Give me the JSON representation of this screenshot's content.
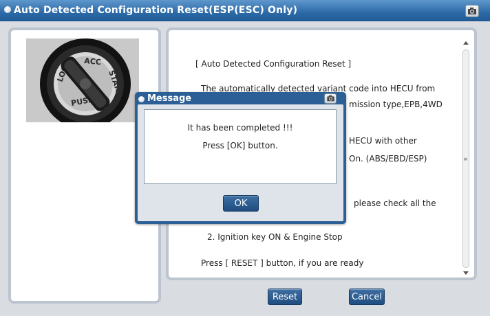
{
  "window": {
    "title": "Auto Detected Configuration Reset(ESP(ESC) Only)"
  },
  "key_photo": {
    "labels": [
      "LOCK",
      "ACC",
      "START",
      "PUSH"
    ]
  },
  "content": {
    "lines": [
      "[ Auto Detected Configuration Reset ]",
      "The automatically detected variant code into HECU from",
      "mission type,EPB,4WD",
      "HECU with other",
      "On. (ABS/EBD/ESP)",
      "please check all the",
      "2. Ignition key ON & Engine Stop",
      "Press [ RESET ] button, if you are ready"
    ]
  },
  "buttons": {
    "reset": "Reset",
    "cancel": "Cancel"
  },
  "message": {
    "title": "Message",
    "line1": "It has been completed !!!",
    "line2": "Press [OK] button.",
    "ok": "OK"
  },
  "colors": {
    "titlebar": "#2d6ba8",
    "button": "#2a5a8e",
    "panel_border": "#bcc4cf"
  }
}
